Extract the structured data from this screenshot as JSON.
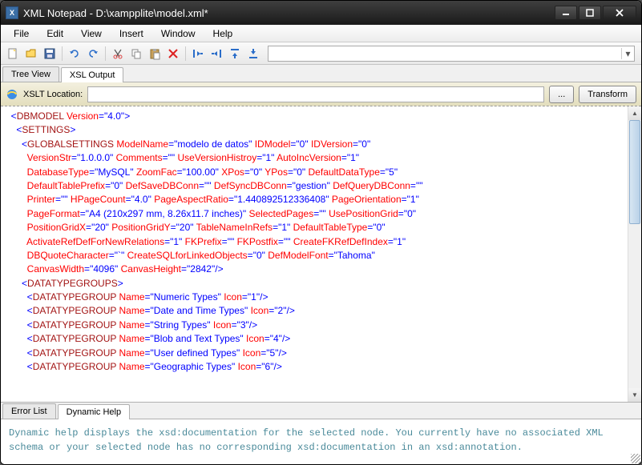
{
  "window": {
    "title": "XML Notepad - D:\\xampplite\\model.xml*",
    "app_icon_letter": "X"
  },
  "menu": {
    "file": "File",
    "edit": "Edit",
    "view": "View",
    "insert": "Insert",
    "window": "Window",
    "help": "Help"
  },
  "toolbar": {
    "icons": {
      "new": "new-file-icon",
      "open": "open-folder-icon",
      "save": "save-icon",
      "undo": "undo-icon",
      "redo": "redo-icon",
      "cut": "cut-icon",
      "copy": "copy-icon",
      "paste": "paste-icon",
      "delete": "delete-icon",
      "indent": "indent-icon",
      "outdent": "outdent-icon",
      "moveup": "move-up-icon",
      "movedown": "move-down-icon"
    }
  },
  "tabs": {
    "tree_view": "Tree View",
    "xsl_output": "XSL Output"
  },
  "xslt": {
    "label": "XSLT Location:",
    "browse": "...",
    "transform": "Transform"
  },
  "bottom_tabs": {
    "error_list": "Error List",
    "dynamic_help": "Dynamic Help"
  },
  "help": {
    "text": "Dynamic help displays the xsd:documentation for the selected node. You currently have no associated XML schema or your selected node has no corresponding xsd:documentation in an xsd:annotation."
  },
  "xml": {
    "root_tag": "DBMODEL",
    "root_attrs": [
      [
        "Version",
        "4.0"
      ]
    ],
    "settings_tag": "SETTINGS",
    "global_tag": "GLOBALSETTINGS",
    "global_attrs_lines": [
      [
        [
          "ModelName",
          "modelo de datos"
        ],
        [
          "IDModel",
          "0"
        ],
        [
          "IDVersion",
          "0"
        ]
      ],
      [
        [
          "VersionStr",
          "1.0.0.0"
        ],
        [
          "Comments",
          ""
        ],
        [
          "UseVersionHistroy",
          "1"
        ],
        [
          "AutoIncVersion",
          "1"
        ]
      ],
      [
        [
          "DatabaseType",
          "MySQL"
        ],
        [
          "ZoomFac",
          "100.00"
        ],
        [
          "XPos",
          "0"
        ],
        [
          "YPos",
          "0"
        ],
        [
          "DefaultDataType",
          "5"
        ]
      ],
      [
        [
          "DefaultTablePrefix",
          "0"
        ],
        [
          "DefSaveDBConn",
          ""
        ],
        [
          "DefSyncDBConn",
          "gestion"
        ],
        [
          "DefQueryDBConn",
          ""
        ]
      ],
      [
        [
          "Printer",
          ""
        ],
        [
          "HPageCount",
          "4.0"
        ],
        [
          "PageAspectRatio",
          "1.440892512336408"
        ],
        [
          "PageOrientation",
          "1"
        ]
      ],
      [
        [
          "PageFormat",
          "A4 (210x297 mm, 8.26x11.7 inches)"
        ],
        [
          "SelectedPages",
          ""
        ],
        [
          "UsePositionGrid",
          "0"
        ]
      ],
      [
        [
          "PositionGridX",
          "20"
        ],
        [
          "PositionGridY",
          "20"
        ],
        [
          "TableNameInRefs",
          "1"
        ],
        [
          "DefaultTableType",
          "0"
        ]
      ],
      [
        [
          "ActivateRefDefForNewRelations",
          "1"
        ],
        [
          "FKPrefix",
          ""
        ],
        [
          "FKPostfix",
          ""
        ],
        [
          "CreateFKRefDefIndex",
          "1"
        ]
      ],
      [
        [
          "DBQuoteCharacter",
          "`"
        ],
        [
          "CreateSQLforLinkedObjects",
          "0"
        ],
        [
          "DefModelFont",
          "Tahoma"
        ]
      ],
      [
        [
          "CanvasWidth",
          "4096"
        ],
        [
          "CanvasHeight",
          "2842"
        ]
      ]
    ],
    "dtg_tag": "DATATYPEGROUPS",
    "dtg_item_tag": "DATATYPEGROUP",
    "dtg_items": [
      {
        "name": "Numeric Types",
        "icon": "1"
      },
      {
        "name": "Date and Time Types",
        "icon": "2"
      },
      {
        "name": "String Types",
        "icon": "3"
      },
      {
        "name": "Blob and Text Types",
        "icon": "4"
      },
      {
        "name": "User defined Types",
        "icon": "5"
      },
      {
        "name": "Geographic Types",
        "icon": "6"
      }
    ]
  }
}
